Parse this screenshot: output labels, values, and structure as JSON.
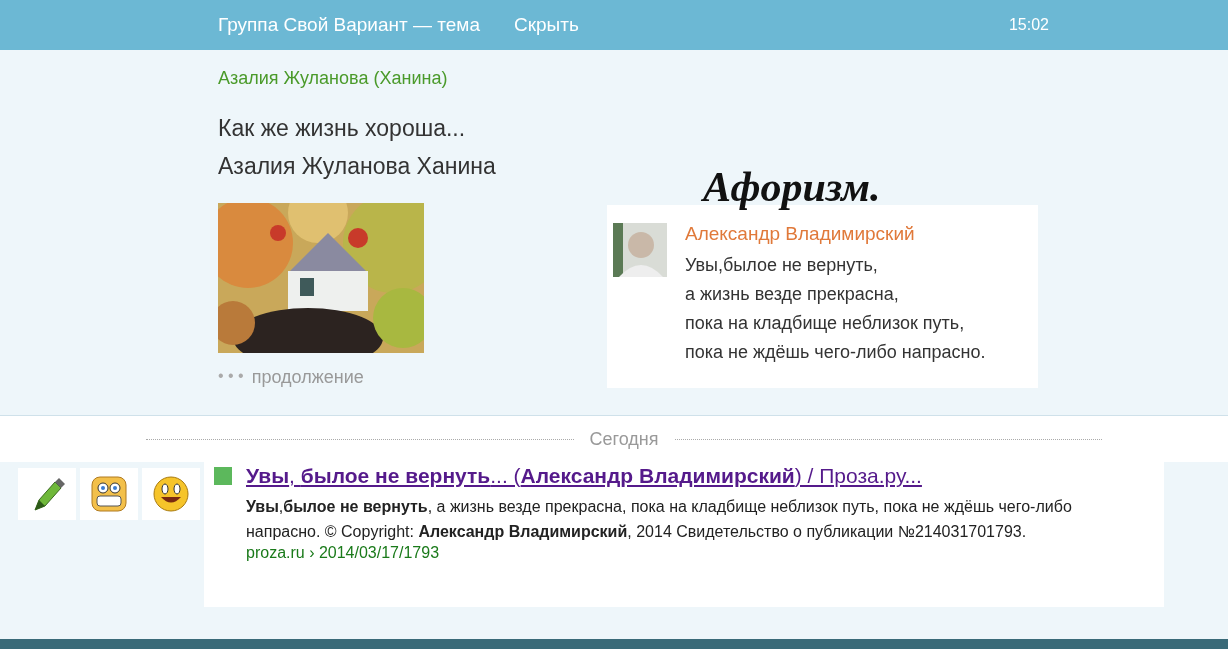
{
  "header": {
    "title": "Группа Свой Вариант — тема",
    "hide_link": "Скрыть",
    "time": "15:02"
  },
  "post": {
    "author": "Азалия Жуланова (Ханина)",
    "title_lines": [
      "Как же жизнь хороша...",
      "Азалия Жуланова Ханина"
    ],
    "image": {
      "kind": "picture"
    },
    "more_dots": "• • •",
    "more": "продолжение"
  },
  "aphorism": {
    "heading": "Афоризм.",
    "author": "Александр Владимирский",
    "lines": [
      "Увы,былое не вернуть,",
      "а жизнь везде прекрасна,",
      "пока на кладбище неблизок путь,",
      "пока не ждёшь чего-либо напрасно."
    ]
  },
  "divider": {
    "label": "Сегодня"
  },
  "stickers": [
    {
      "kind": "pencil"
    },
    {
      "kind": "grin"
    },
    {
      "kind": "smile"
    }
  ],
  "search_result": {
    "title": "**Увы**, **былое не вернуть**... (**Александр Владимирский**) / Проза.ру...",
    "snippet": "**Увы**,**былое не вернуть**, а жизнь везде прекрасна, пока на кладбище неблизок путь, пока не ждёшь чего-либо напрасно. © Copyright: **Александр Владимирский**, 2014 Свидетельство о публикации №214031701793.",
    "url": "proza.ru › 2014/03/17/1793"
  }
}
